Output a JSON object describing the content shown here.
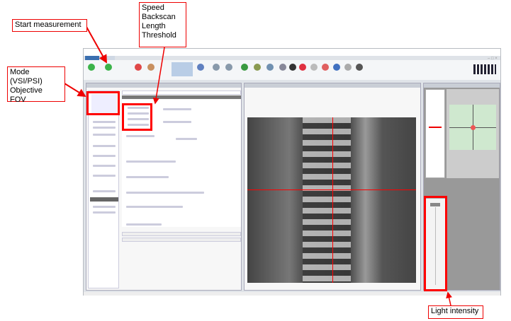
{
  "annotations": {
    "start_measurement": "Start measurement",
    "speed_group": [
      "Speed",
      "Backscan",
      "Length",
      "Threshold"
    ],
    "mode_group": [
      "Mode (VSI/PSI)",
      "Objective",
      "FOV"
    ],
    "light_intensity": "Light intensity"
  },
  "colors": {
    "annotation": "#ff0000",
    "stage_green": "#cfe8cf"
  }
}
